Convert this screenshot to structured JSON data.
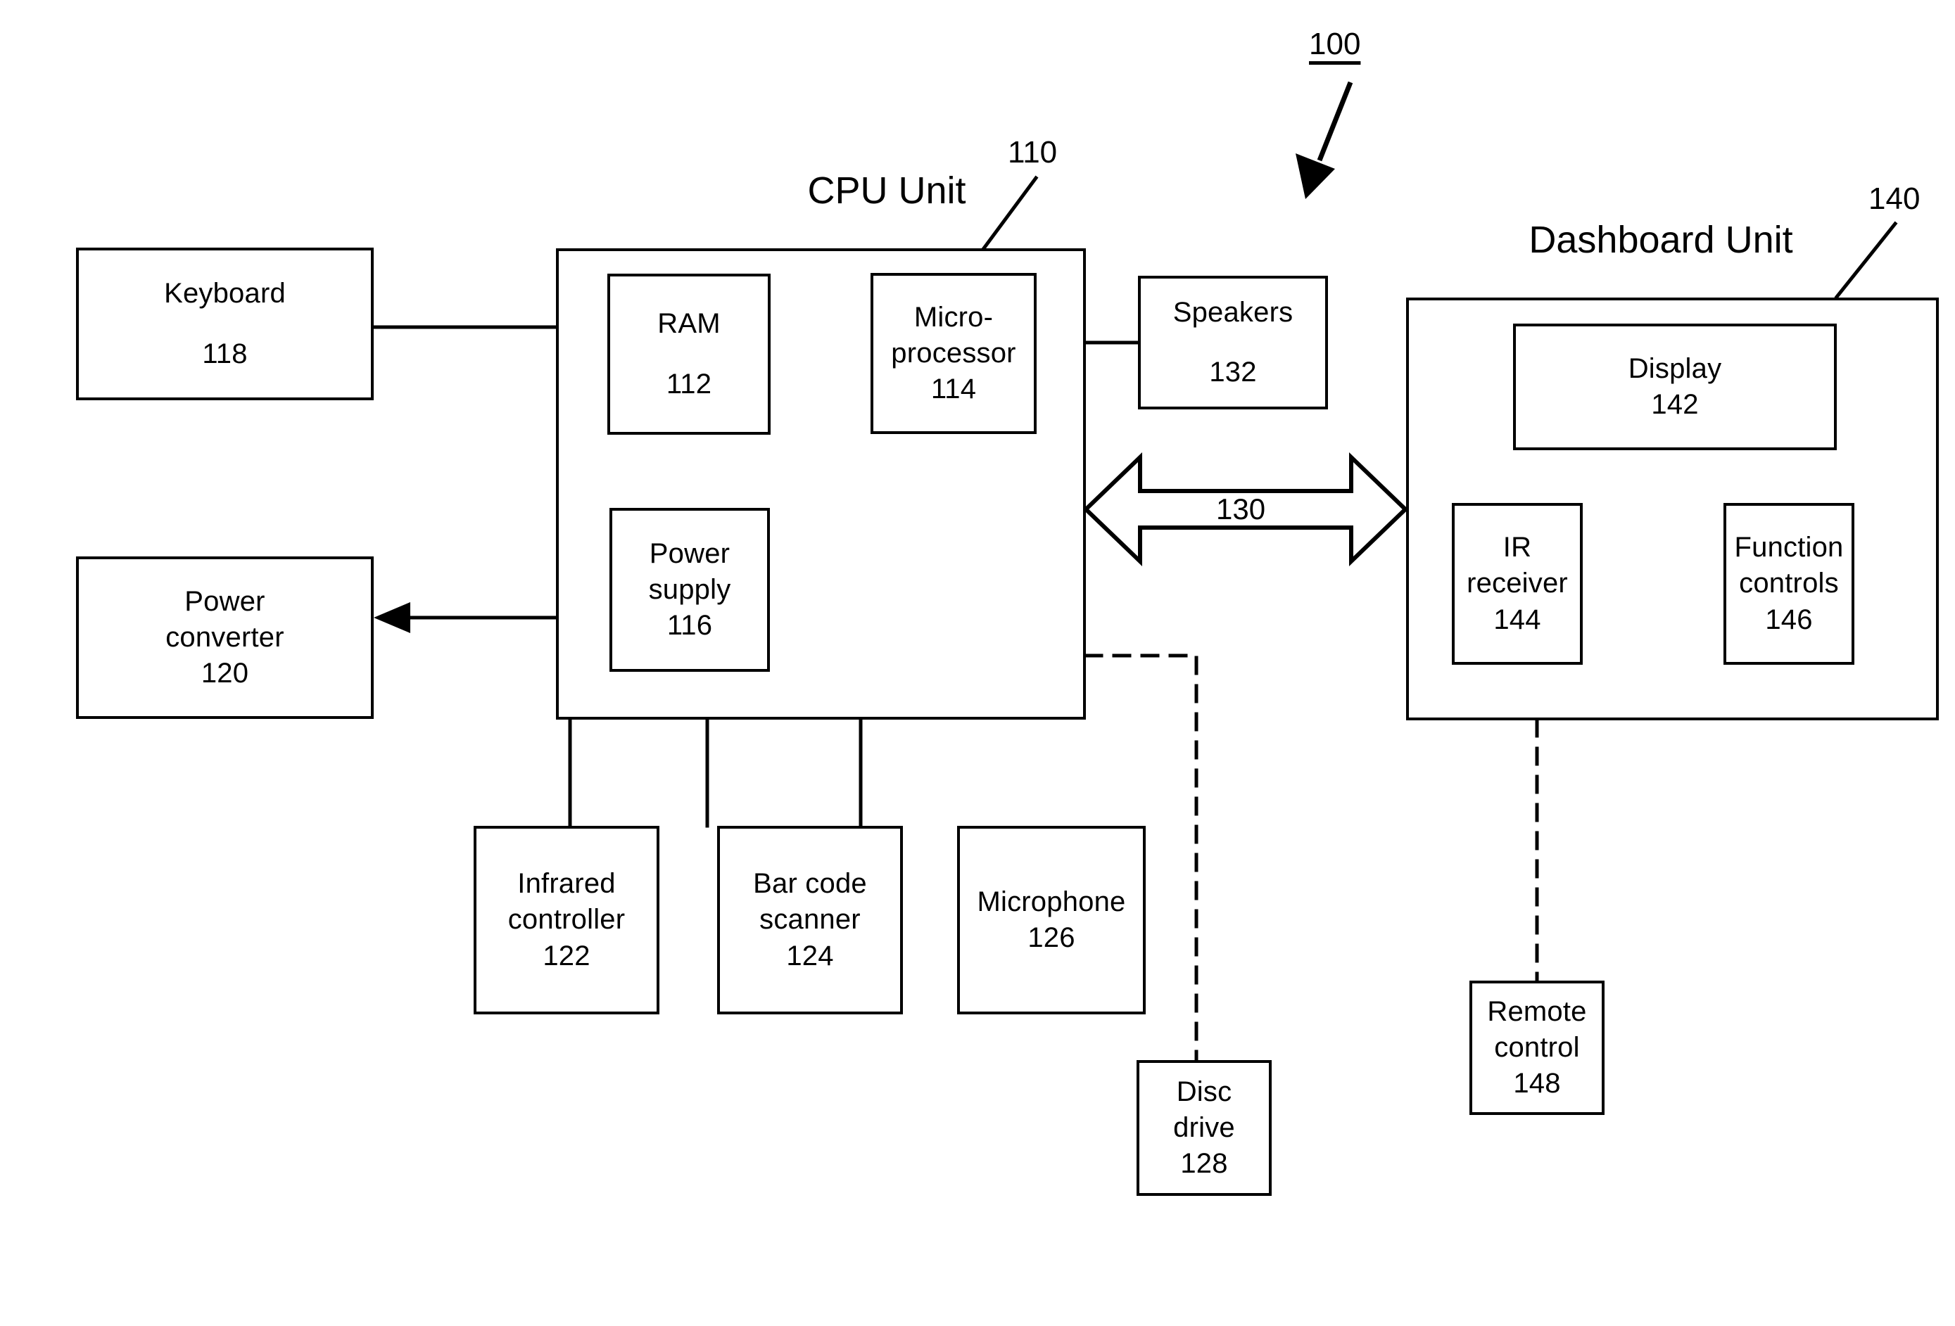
{
  "figure": {
    "system_ref": "100",
    "cpu_unit_title": "CPU Unit",
    "cpu_unit_ref": "110",
    "dashboard_unit_title": "Dashboard Unit",
    "dashboard_unit_ref": "140",
    "bus_label": "130"
  },
  "nodes": {
    "keyboard": {
      "label": "Keyboard",
      "num": "118"
    },
    "ram": {
      "label": "RAM",
      "num": "112"
    },
    "microprocessor": {
      "label": "Micro-\nprocessor",
      "num": "114"
    },
    "power_supply": {
      "label": "Power\nsupply",
      "num": "116"
    },
    "power_converter": {
      "label": "Power\nconverter",
      "num": "120"
    },
    "speakers": {
      "label": "Speakers",
      "num": "132"
    },
    "infrared_controller": {
      "label": "Infrared\ncontroller",
      "num": "122"
    },
    "bar_code_scanner": {
      "label": "Bar code\nscanner",
      "num": "124"
    },
    "microphone": {
      "label": "Microphone",
      "num": "126"
    },
    "disc_drive": {
      "label": "Disc\ndrive",
      "num": "128"
    },
    "display": {
      "label": "Display",
      "num": "142"
    },
    "ir_receiver": {
      "label": "IR\nreceiver",
      "num": "144"
    },
    "function_controls": {
      "label": "Function\ncontrols",
      "num": "146"
    },
    "remote_control": {
      "label": "Remote\ncontrol",
      "num": "148"
    }
  },
  "colors": {
    "ink": "#000000",
    "paper": "#ffffff"
  }
}
